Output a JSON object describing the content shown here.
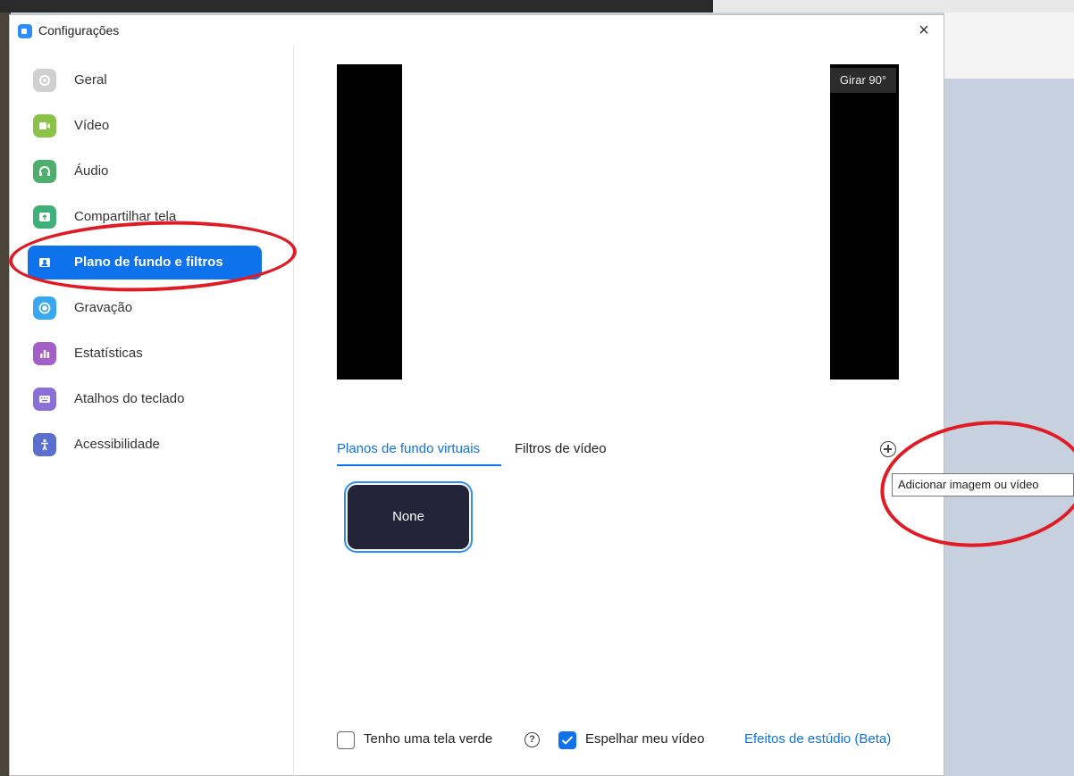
{
  "window": {
    "title": "Configurações",
    "close_label": "×"
  },
  "sidebar": {
    "items": [
      {
        "label": "Geral",
        "icon": "gear-icon",
        "color": "#c8c8c8"
      },
      {
        "label": "Vídeo",
        "icon": "video-camera-icon",
        "color": "#8bc34a"
      },
      {
        "label": "Áudio",
        "icon": "headphones-icon",
        "color": "#4caf6e"
      },
      {
        "label": "Compartilhar tela",
        "icon": "share-screen-icon",
        "color": "#3fb07a"
      },
      {
        "label": "Plano de fundo e filtros",
        "icon": "background-icon",
        "color": "#0e72ed",
        "active": true
      },
      {
        "label": "Gravação",
        "icon": "record-icon",
        "color": "#3aa8f0"
      },
      {
        "label": "Estatísticas",
        "icon": "chart-icon",
        "color": "#a35ec8"
      },
      {
        "label": "Atalhos do teclado",
        "icon": "keyboard-icon",
        "color": "#8a6fd6"
      },
      {
        "label": "Acessibilidade",
        "icon": "accessibility-icon",
        "color": "#5b6fcf"
      }
    ]
  },
  "preview": {
    "rotate_label": "Girar 90°"
  },
  "tabs": {
    "virtual_backgrounds": "Planos de fundo virtuais",
    "video_filters": "Filtros de vídeo"
  },
  "add_button": {
    "tooltip": "Adicionar imagem ou vídeo"
  },
  "backgrounds": {
    "none_label": "None"
  },
  "options": {
    "green_screen_label": "Tenho uma tela verde",
    "green_screen_checked": false,
    "help_glyph": "?",
    "mirror_label": "Espelhar meu vídeo",
    "mirror_checked": true,
    "studio_effects_label": "Efeitos de estúdio (Beta)"
  },
  "annotation_color": "#e01b24"
}
